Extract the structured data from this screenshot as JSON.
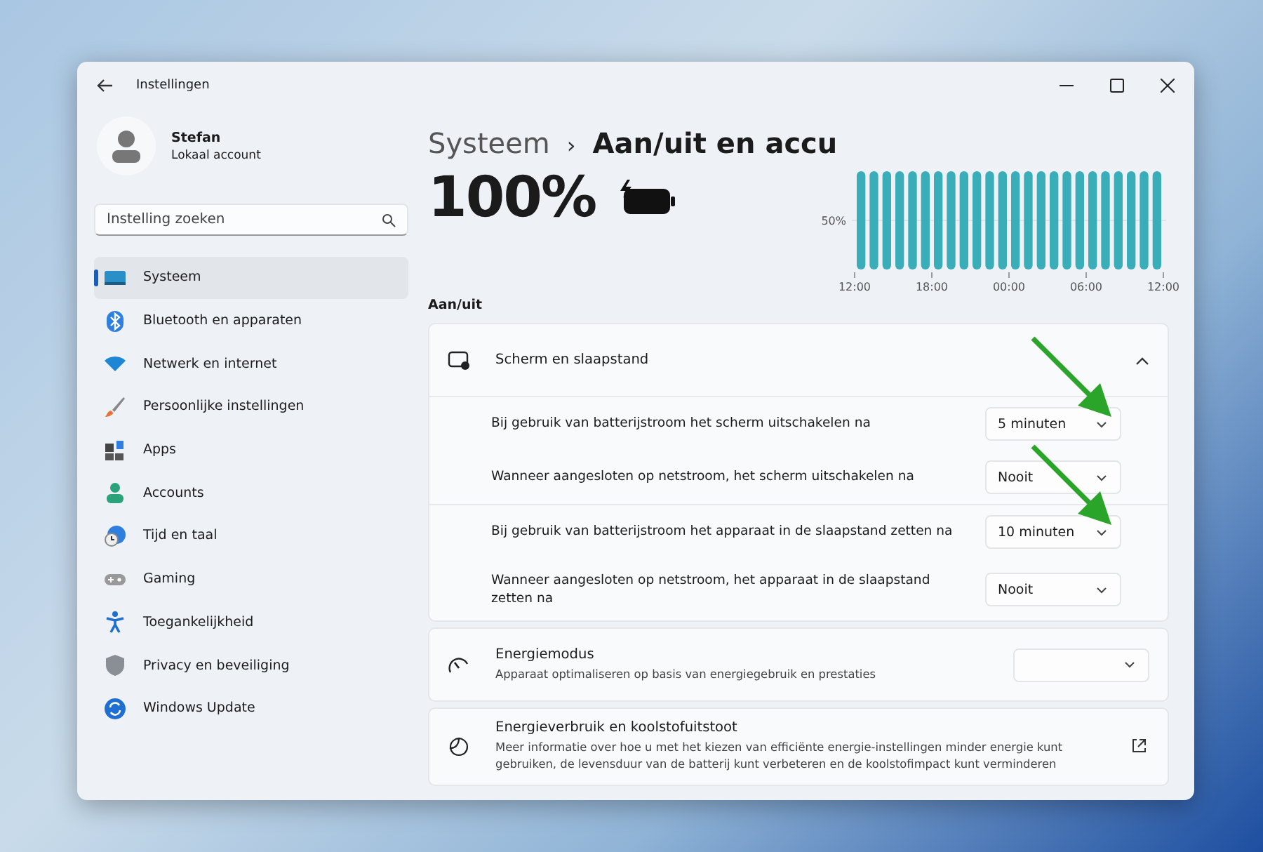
{
  "window": {
    "title": "Instellingen"
  },
  "profile": {
    "name": "Stefan",
    "account": "Lokaal account"
  },
  "search": {
    "placeholder": "Instelling zoeken"
  },
  "sidebar": {
    "items": [
      {
        "label": "Systeem",
        "selected": true
      },
      {
        "label": "Bluetooth en apparaten",
        "selected": false
      },
      {
        "label": "Netwerk en internet",
        "selected": false
      },
      {
        "label": "Persoonlijke instellingen",
        "selected": false
      },
      {
        "label": "Apps",
        "selected": false
      },
      {
        "label": "Accounts",
        "selected": false
      },
      {
        "label": "Tijd en taal",
        "selected": false
      },
      {
        "label": "Gaming",
        "selected": false
      },
      {
        "label": "Toegankelijkheid",
        "selected": false
      },
      {
        "label": "Privacy en beveiliging",
        "selected": false
      },
      {
        "label": "Windows Update",
        "selected": false
      }
    ]
  },
  "breadcrumb": {
    "parent": "Systeem",
    "separator": "›",
    "current": "Aan/uit en accu"
  },
  "battery": {
    "percent": "100%",
    "charging": true
  },
  "usage_chart": {
    "y_label": "50%",
    "x_labels": [
      "12:00",
      "18:00",
      "00:00",
      "06:00",
      "12:00"
    ]
  },
  "section_title": "Aan/uit",
  "screen_sleep": {
    "title": "Scherm en slaapstand",
    "expanded": true,
    "rows": [
      {
        "label": "Bij gebruik van batterijstroom het scherm uitschakelen na",
        "value": "5 minuten",
        "arrow": true
      },
      {
        "label": "Wanneer aangesloten op netstroom, het scherm uitschakelen na",
        "value": "Nooit",
        "arrow": false
      },
      {
        "label": "Bij gebruik van batterijstroom het apparaat in de slaapstand zetten na",
        "value": "10 minuten",
        "arrow": true
      },
      {
        "label": "Wanneer aangesloten op netstroom, het apparaat in de slaapstand zetten na",
        "value": "Nooit",
        "arrow": false
      }
    ]
  },
  "energy_mode": {
    "title": "Energiemodus",
    "description": "Apparaat optimaliseren op basis van energiegebruik en prestaties"
  },
  "energy_usage": {
    "title": "Energieverbruik en koolstofuitstoot",
    "description": "Meer informatie over hoe u met het kiezen van efficiënte energie-instellingen minder energie kunt gebruiken, de levensduur van de batterij kunt verbeteren en de koolstofimpact kunt verminderen"
  }
}
